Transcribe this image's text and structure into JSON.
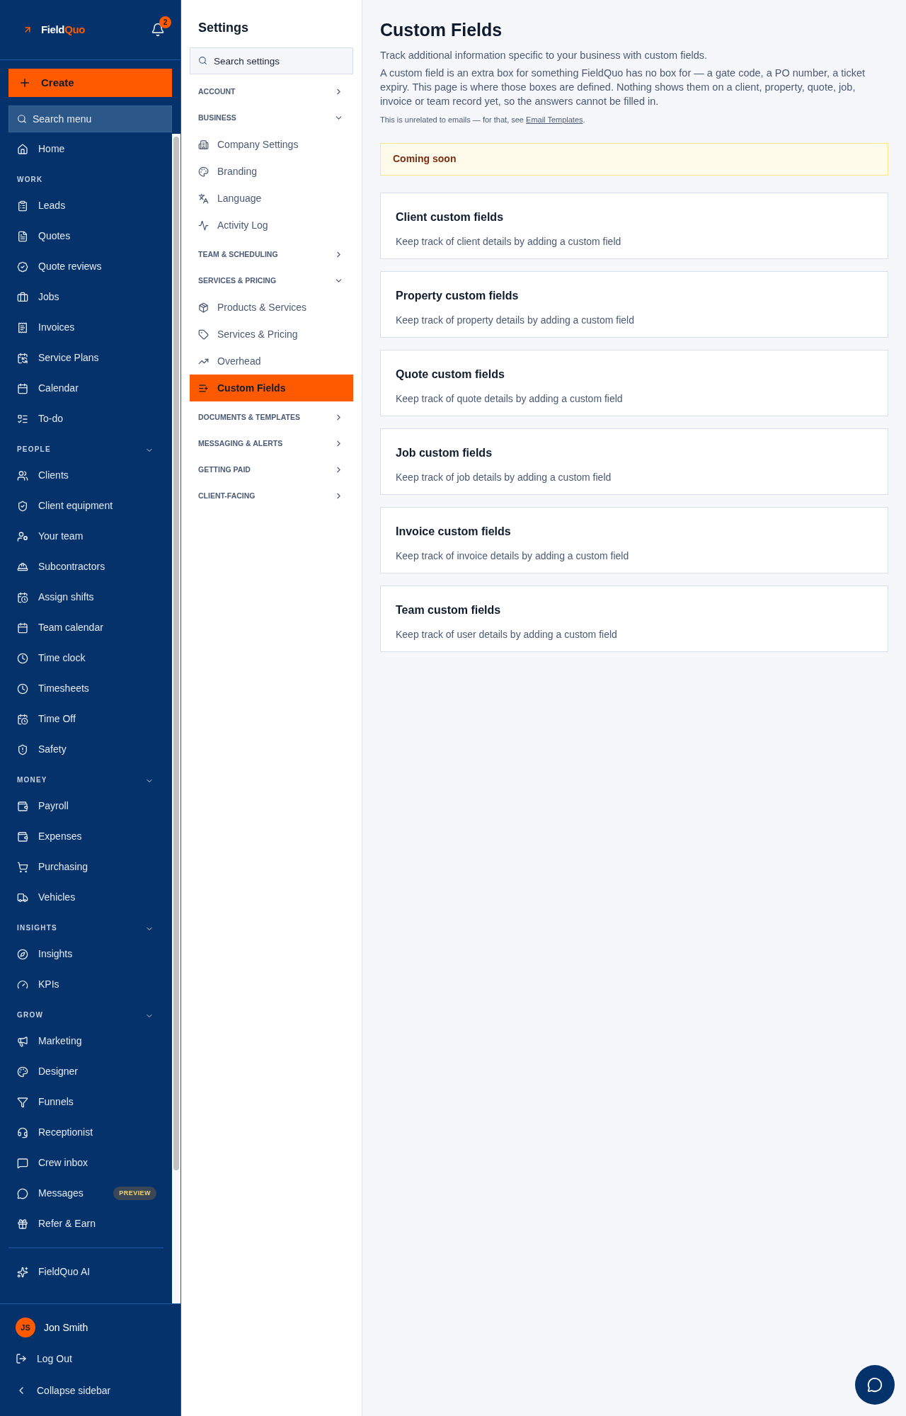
{
  "sidebar": {
    "brand": {
      "first": "Field",
      "second": "Quo"
    },
    "notifications": {
      "count": "2"
    },
    "create_button": "Create",
    "search": {
      "placeholder": "Search menu"
    },
    "groups": [
      {
        "items": [
          {
            "label": "Home",
            "selected": false
          }
        ]
      },
      {
        "label": "WORK",
        "items": [
          {
            "label": "Leads",
            "selected": false
          },
          {
            "label": "Quotes",
            "selected": false
          },
          {
            "label": "Quote reviews",
            "selected": false
          },
          {
            "label": "Jobs",
            "selected": false
          },
          {
            "label": "Invoices",
            "selected": false
          },
          {
            "label": "Service Plans",
            "selected": false
          },
          {
            "label": "Calendar",
            "selected": false
          },
          {
            "label": "To-do",
            "selected": false
          }
        ]
      },
      {
        "label": "PEOPLE",
        "expanded": true,
        "items": [
          {
            "label": "Clients",
            "selected": false
          },
          {
            "label": "Client equipment",
            "selected": false
          },
          {
            "label": "Your team",
            "selected": false
          },
          {
            "label": "Subcontractors",
            "selected": false
          },
          {
            "label": "Assign shifts",
            "selected": false
          },
          {
            "label": "Team calendar",
            "selected": false
          },
          {
            "label": "Time clock",
            "selected": false
          },
          {
            "label": "Timesheets",
            "selected": false
          },
          {
            "label": "Time Off",
            "selected": false
          },
          {
            "label": "Safety",
            "selected": false
          }
        ]
      },
      {
        "label": "MONEY",
        "expanded": true,
        "items": [
          {
            "label": "Payroll",
            "selected": false
          },
          {
            "label": "Expenses",
            "selected": false
          },
          {
            "label": "Purchasing",
            "selected": false
          },
          {
            "label": "Vehicles",
            "selected": false
          }
        ]
      },
      {
        "label": "INSIGHTS",
        "expanded": true,
        "items": [
          {
            "label": "Insights",
            "selected": false
          },
          {
            "label": "KPIs",
            "selected": false
          }
        ]
      },
      {
        "label": "GROW",
        "expanded": true,
        "items": [
          {
            "label": "Marketing",
            "selected": false
          },
          {
            "label": "Designer",
            "selected": false
          },
          {
            "label": "Funnels",
            "selected": false
          },
          {
            "label": "Receptionist",
            "selected": false
          },
          {
            "label": "Crew inbox",
            "selected": false
          },
          {
            "label": "Messages",
            "selected": false,
            "badge": "PREVIEW"
          },
          {
            "label": "Refer & Earn",
            "selected": false
          }
        ]
      },
      {
        "divider": true,
        "items": [
          {
            "label": "FieldQuo AI",
            "selected": false
          }
        ]
      }
    ],
    "user": {
      "initials": "JS",
      "name": "Jon Smith"
    },
    "log_out": "Log Out",
    "collapse": "Collapse sidebar"
  },
  "settings": {
    "title": "Settings",
    "search": {
      "placeholder": "Search settings"
    },
    "sections": [
      {
        "label": "ACCOUNT",
        "expanded": false
      },
      {
        "label": "BUSINESS",
        "expanded": true,
        "items": [
          {
            "label": "Company Settings",
            "selected": false
          },
          {
            "label": "Branding",
            "selected": false
          },
          {
            "label": "Language",
            "selected": false
          },
          {
            "label": "Activity Log",
            "selected": false
          }
        ]
      },
      {
        "label": "TEAM & SCHEDULING",
        "expanded": false
      },
      {
        "label": "SERVICES & PRICING",
        "expanded": true,
        "items": [
          {
            "label": "Products & Services",
            "selected": false
          },
          {
            "label": "Services & Pricing",
            "selected": false
          },
          {
            "label": "Overhead",
            "selected": false
          },
          {
            "label": "Custom Fields",
            "selected": true
          }
        ]
      },
      {
        "label": "DOCUMENTS & TEMPLATES",
        "expanded": false
      },
      {
        "label": "MESSAGING & ALERTS",
        "expanded": false
      },
      {
        "label": "GETTING PAID",
        "expanded": false
      },
      {
        "label": "CLIENT-FACING",
        "expanded": false
      }
    ]
  },
  "main": {
    "title": "Custom Fields",
    "intro": "Track additional information specific to your business with custom fields.",
    "explanation": "A custom field is an extra box for something FieldQuo has no box for — a gate code, a PO number, a ticket expiry. This page is where those boxes are defined. Nothing shows them on a client, property, quote, job, invoice or team record yet, so the answers cannot be filled in.",
    "note": {
      "before": "This is unrelated to emails — for that, see ",
      "link": "Email Templates",
      "after": "."
    },
    "banner": "Coming soon",
    "cards": [
      {
        "title": "Client custom fields",
        "description": "Keep track of client details by adding a custom field"
      },
      {
        "title": "Property custom fields",
        "description": "Keep track of property details by adding a custom field"
      },
      {
        "title": "Quote custom fields",
        "description": "Keep track of quote details by adding a custom field"
      },
      {
        "title": "Job custom fields",
        "description": "Keep track of job details by adding a custom field"
      },
      {
        "title": "Invoice custom fields",
        "description": "Keep track of invoice details by adding a custom field"
      },
      {
        "title": "Team custom fields",
        "description": "Keep track of user details by adding a custom field"
      }
    ]
  }
}
